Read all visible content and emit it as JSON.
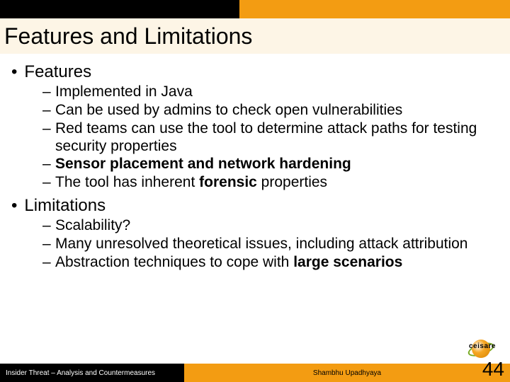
{
  "header": {
    "title": "Features and Limitations"
  },
  "content": {
    "sections": [
      {
        "label": "Features",
        "items": [
          {
            "segments": [
              {
                "t": "Implemented in Java",
                "b": false
              }
            ]
          },
          {
            "segments": [
              {
                "t": "Can be used by admins to check open vulnerabilities",
                "b": false
              }
            ]
          },
          {
            "segments": [
              {
                "t": "Red teams can use the tool to determine attack paths for testing security properties",
                "b": false
              }
            ]
          },
          {
            "segments": [
              {
                "t": "Sensor placement and network hardening",
                "b": true
              }
            ]
          },
          {
            "segments": [
              {
                "t": "The tool has inherent ",
                "b": false
              },
              {
                "t": "forensic",
                "b": true
              },
              {
                "t": " properties",
                "b": false
              }
            ]
          }
        ]
      },
      {
        "label": "Limitations",
        "items": [
          {
            "segments": [
              {
                "t": "Scalability?",
                "b": false
              }
            ]
          },
          {
            "segments": [
              {
                "t": "Many unresolved theoretical issues, including attack attribution",
                "b": false
              }
            ]
          },
          {
            "segments": [
              {
                "t": "Abstraction techniques to cope with ",
                "b": false
              },
              {
                "t": "large scenarios",
                "b": true
              }
            ]
          }
        ]
      }
    ]
  },
  "footer": {
    "left": "Insider Threat – Analysis and Countermeasures",
    "author": "Shambhu Upadhyaya",
    "page": "44"
  },
  "logo": {
    "text": "ceisare"
  }
}
